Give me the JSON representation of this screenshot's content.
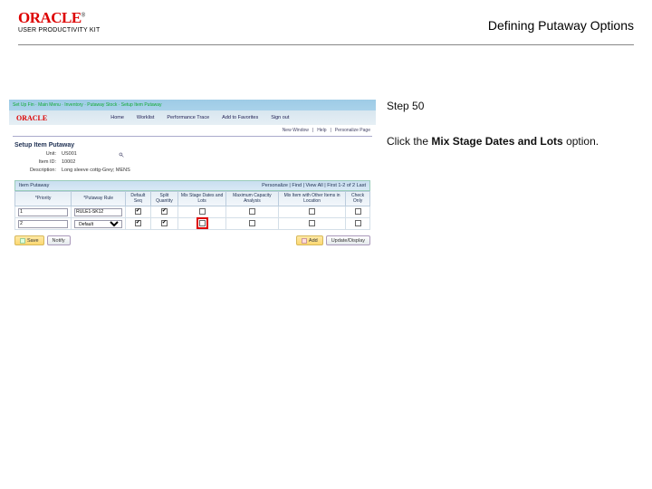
{
  "logo": {
    "brand": "ORACLE",
    "tm": "®",
    "sub": "USER PRODUCTIVITY KIT"
  },
  "header": {
    "title": "Defining Putaway Options"
  },
  "instruction": {
    "step": "Step 50",
    "pre": "Click the ",
    "bold": "Mix Stage Dates and Lots",
    "post": " option."
  },
  "app": {
    "breadcrumb": "Set Up Fin · Main Menu · Inventory · Putaway Stock · Setup Item Putaway",
    "brand": "ORACLE",
    "nav": [
      "Home",
      "Worklist",
      "Performance Trace",
      "Add to Favorites",
      "Sign out"
    ],
    "subline": {
      "a": "New Window",
      "b": "Help",
      "c": "Personalize Page"
    },
    "setup": {
      "title": "Setup Item Putaway",
      "unitLabel": "Unit:",
      "unitValue": "US001",
      "itemLabel": "Item ID:",
      "itemValue": "10002",
      "descLabel": "Description:",
      "descValue": "Long sleeve cottg-Grey; MENS"
    },
    "tableBar": {
      "left": "Item Putaway",
      "right": "Personalize | Find | View All |  First 1-2 of 2  Last"
    },
    "columns": [
      "*Priority",
      "*Putaway Rule",
      "Default Seq",
      "Split Quantity",
      "Mix Stage Dates and Lots",
      "Maximum Capacity Analysis",
      "Mix Item with Other Items in Location",
      "Check Only"
    ],
    "rows": [
      {
        "priority": "1",
        "rule": "RULE1-SK12",
        "defaultSeq": true,
        "split": true,
        "mixStage": false,
        "maxCap": false,
        "mixOther": false,
        "checkOnly": false,
        "highlight": false
      },
      {
        "priority": "2",
        "rule": "Default",
        "isSelect": true,
        "defaultSeq": true,
        "split": true,
        "mixStage": false,
        "maxCap": false,
        "mixOther": false,
        "checkOnly": false,
        "highlight": true
      }
    ],
    "footer": {
      "save": "Save",
      "notify": "Notify",
      "add": "Add",
      "update": "Update/Display"
    }
  }
}
